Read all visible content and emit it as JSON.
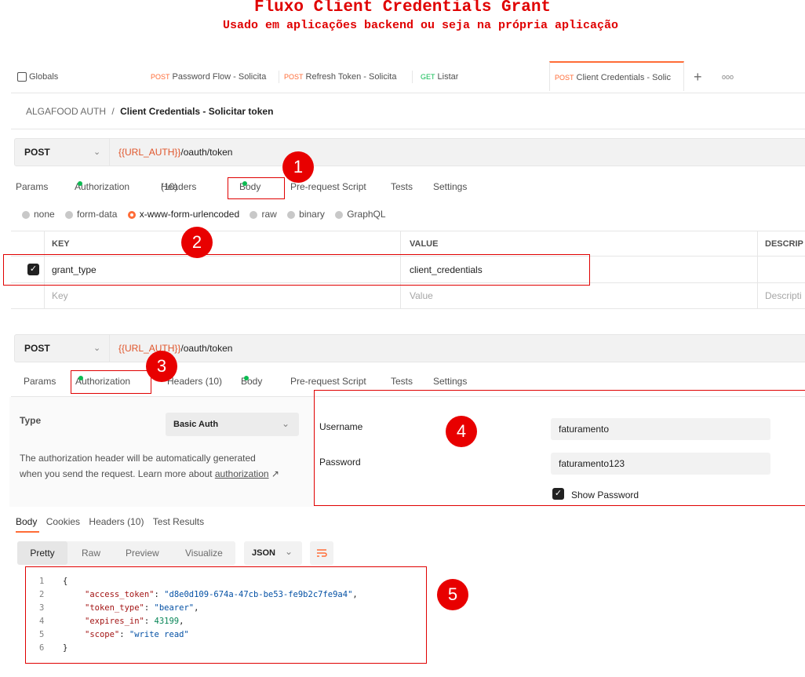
{
  "header": {
    "title": "Fluxo Client Credentials Grant",
    "subtitle": "Usado em aplicações backend ou seja na própria aplicação"
  },
  "tabs": {
    "globals": "Globals",
    "items": [
      {
        "method": "POST",
        "label": "Password Flow - Solicita"
      },
      {
        "method": "POST",
        "label": "Refresh Token - Solicita"
      },
      {
        "method": "GET",
        "label": "Listar"
      },
      {
        "method": "POST",
        "label": "Client Credentials - Solic"
      }
    ],
    "add": "+",
    "more": "ooo"
  },
  "breadcrumb": {
    "collection": "ALGAFOOD AUTH",
    "sep": "/",
    "request": "Client Credentials - Solicitar token"
  },
  "request1": {
    "method": "POST",
    "url_var": "{{URL_AUTH}}",
    "url_path": "/oauth/token",
    "subtabs": {
      "params": "Params",
      "authorization": "Authorization",
      "headers": "Headers",
      "headers_count": "(10)",
      "body": "Body",
      "prerequest": "Pre-request Script",
      "tests": "Tests",
      "settings": "Settings"
    },
    "body_types": [
      "none",
      "form-data",
      "x-www-form-urlencoded",
      "raw",
      "binary",
      "GraphQL"
    ],
    "table": {
      "col_key": "KEY",
      "col_value": "VALUE",
      "col_desc": "DESCRIP",
      "row_key": "grant_type",
      "row_value": "client_credentials",
      "ph_key": "Key",
      "ph_value": "Value",
      "ph_desc": "Descripti"
    }
  },
  "request2": {
    "method": "POST",
    "url_var": "{{URL_AUTH}}",
    "url_path": "/oauth/token",
    "subtabs": {
      "params": "Params",
      "authorization": "Authorization",
      "headers": "Headers (10)",
      "body": "Body",
      "prerequest": "Pre-request Script",
      "tests": "Tests",
      "settings": "Settings"
    },
    "auth": {
      "type_label": "Type",
      "type_value": "Basic Auth",
      "desc_line1": "The authorization header will be automatically generated",
      "desc_line2": "when you send the request. Learn more about ",
      "desc_link": "authorization",
      "link_arrow": "↗",
      "username_label": "Username",
      "username_value": "faturamento",
      "password_label": "Password",
      "password_value": "faturamento123",
      "show_password": "Show Password"
    }
  },
  "response": {
    "tabs": {
      "body": "Body",
      "cookies": "Cookies",
      "headers": "Headers (10)",
      "tests": "Test Results"
    },
    "view": {
      "pretty": "Pretty",
      "raw": "Raw",
      "preview": "Preview",
      "visualize": "Visualize",
      "format": "JSON"
    },
    "line_numbers": [
      "1",
      "2",
      "3",
      "4",
      "5",
      "6"
    ],
    "open_brace": "{",
    "close_brace": "}",
    "lines": [
      {
        "key": "\"access_token\"",
        "value": "\"d8e0d109-674a-47cb-be53-fe9b2c7fe9a4\"",
        "trail": ","
      },
      {
        "key": "\"token_type\"",
        "value": "\"bearer\"",
        "trail": ","
      },
      {
        "key": "\"expires_in\"",
        "value": "43199",
        "trail": ","
      },
      {
        "key": "\"scope\"",
        "value": "\"write read\"",
        "trail": ""
      }
    ]
  },
  "badges": [
    "1",
    "2",
    "3",
    "4",
    "5"
  ]
}
